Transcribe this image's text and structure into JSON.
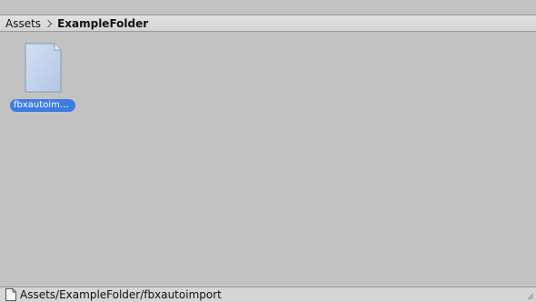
{
  "breadcrumb": {
    "items": [
      {
        "label": "Assets"
      },
      {
        "label": "ExampleFolder"
      }
    ]
  },
  "assets": [
    {
      "name": "fbxautoimp…",
      "icon": "file-icon",
      "selected": true
    }
  ],
  "status_bar": {
    "path": "Assets/ExampleFolder/fbxautoimport",
    "icon": "file-icon"
  },
  "colors": {
    "selection": "#3d7ce0",
    "background": "#c2c2c2"
  }
}
